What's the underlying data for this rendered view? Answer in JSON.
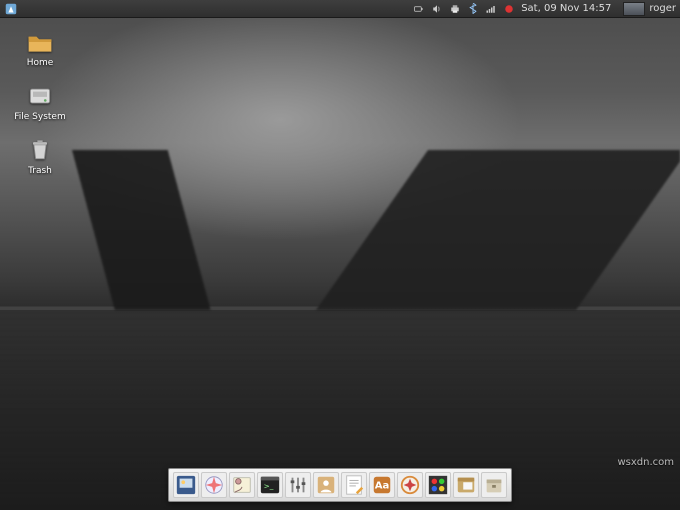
{
  "panel": {
    "clock": "Sat, 09 Nov  14:57",
    "user": "roger",
    "tray_icons": {
      "power": "power-icon",
      "volume": "volume-icon",
      "printer": "printer-icon",
      "bluetooth": "bluetooth-icon",
      "network": "network-signal-icon",
      "updates": "updates-icon"
    }
  },
  "desktop": {
    "icons": {
      "home_label": "Home",
      "filesystem_label": "File System",
      "trash_label": "Trash"
    }
  },
  "dock": {
    "items": [
      {
        "name": "screenshot-app-icon"
      },
      {
        "name": "safari-browser-icon"
      },
      {
        "name": "mail-app-icon"
      },
      {
        "name": "terminal-app-icon"
      },
      {
        "name": "settings-app-icon"
      },
      {
        "name": "contacts-app-icon"
      },
      {
        "name": "textedit-app-icon"
      },
      {
        "name": "dictionary-app-icon"
      },
      {
        "name": "compass-app-icon"
      },
      {
        "name": "appearance-app-icon"
      },
      {
        "name": "files-app-icon"
      },
      {
        "name": "archive-app-icon"
      }
    ]
  },
  "watermark": "wsxdn.com"
}
